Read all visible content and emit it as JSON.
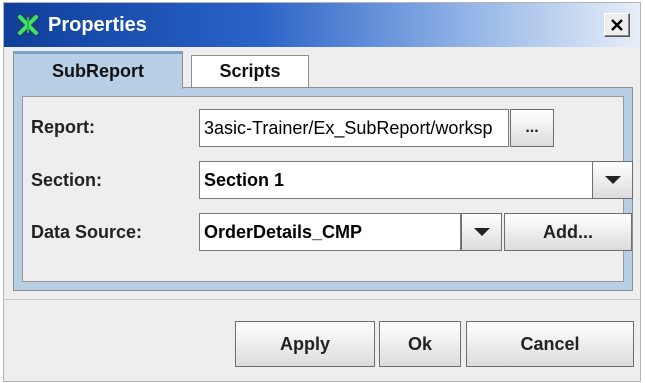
{
  "window": {
    "title": "Properties",
    "close_label": "✕"
  },
  "tabs": [
    {
      "label": "SubReport",
      "active": true
    },
    {
      "label": "Scripts",
      "active": false
    }
  ],
  "form": {
    "report": {
      "label": "Report:",
      "value": "3asic-Trainer/Ex_SubReport/worksp",
      "browse_label": "..."
    },
    "section": {
      "label": "Section:",
      "value": "Section 1"
    },
    "data_source": {
      "label": "Data Source:",
      "value": "OrderDetails_CMP",
      "add_label": "Add..."
    }
  },
  "buttons": {
    "apply": "Apply",
    "ok": "Ok",
    "cancel": "Cancel"
  },
  "colors": {
    "titlebar_start": "#0f3f9b",
    "tab_active": "#b8cfe6",
    "panel_bg": "#eeeeee"
  }
}
